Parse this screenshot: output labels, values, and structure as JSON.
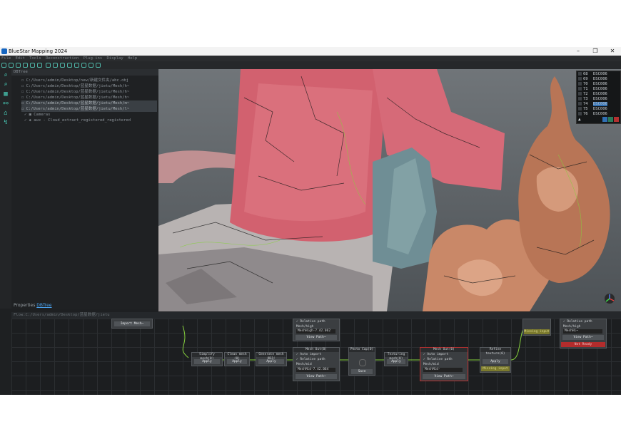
{
  "window": {
    "title": "BlueStar Mapping 2024",
    "minimize_glyph": "–",
    "maximize_glyph": "❐",
    "close_glyph": "✕"
  },
  "menu": [
    "File",
    "Edit",
    "Tools",
    "Reconstruction",
    "Plug-ins",
    "Display",
    "Help"
  ],
  "tree": {
    "title": "DBTree",
    "rows": [
      {
        "label": "C:/Users/admin/Desktop/new/新建文件夹/abc.obj"
      },
      {
        "label": "C:/Users/admin/Desktop/蓝星数据/jietu/Mesh/h~"
      },
      {
        "label": "C:/Users/admin/Desktop/蓝星数据/jietu/Mesh/h~"
      },
      {
        "label": "C:/Users/admin/Desktop/蓝星数据/jietu/Mesh/h~"
      },
      {
        "label": "C:/Users/admin/Desktop/蓝星数据/jietu/Mesh/m~"
      },
      {
        "label": "C:/Users/admin/Desktop/蓝星数据/jietu/Mesh/l~"
      },
      {
        "label": "Cameras"
      },
      {
        "label": "aux - Cloud_extract_registered_registered"
      }
    ]
  },
  "bottom_tabs": {
    "properties": "Properties",
    "dbtree": "DBTree"
  },
  "images": {
    "rows": [
      {
        "num": "68",
        "name": "DSC006"
      },
      {
        "num": "69",
        "name": "DSC006"
      },
      {
        "num": "70",
        "name": "DSC006"
      },
      {
        "num": "71",
        "name": "DSC006"
      },
      {
        "num": "72",
        "name": "DSC006"
      },
      {
        "num": "73",
        "name": "DSC006"
      },
      {
        "num": "74",
        "name": "DSC006"
      },
      {
        "num": "75",
        "name": "DSC006"
      },
      {
        "num": "76",
        "name": "DSC006"
      }
    ]
  },
  "flow": {
    "path_label": "Flow:C:/Users/admin/Desktop/蓝星数据/jietu",
    "nodes": {
      "import": {
        "button": "Import Mesh~"
      },
      "simplify": {
        "title": "Simplify mesh(0)",
        "button": "Apply"
      },
      "clean": {
        "title": "Clean mesh (0)",
        "button": "Apply"
      },
      "generate": {
        "title": "Generate mesh OBJ(",
        "button": "Apply"
      },
      "mesh_out_top": {
        "relative": "✓ Relative path",
        "mesh": "Mesh/high",
        "field": "MeshHigh-7.42.062",
        "button": "View Path~"
      },
      "mesh_out_mid": {
        "title": "Mesh Out(0)",
        "auto": "✓ Auto import",
        "relative": "✓ Relative path",
        "mesh": "Mesh/mid",
        "field": "MeshMid-7.42.064",
        "button": "View Path~"
      },
      "photo_cap": {
        "title": "Photo Cap(0)",
        "button": "Save"
      },
      "texturing": {
        "title": "Texturing mesh(0)",
        "button": "Apply"
      },
      "mesh_out_low": {
        "title": "Mesh Out(0)",
        "auto": "✓ Auto import",
        "relative": "✓ Relative path",
        "mesh": "Mesh/mid",
        "field": "MeshMid-",
        "button": "View Path~"
      },
      "refine": {
        "title": "Refine texture(0)",
        "button1": "Apply",
        "button2": "Missing input"
      },
      "right_top": {
        "relative": "✓ Relative path",
        "mesh": "Mesh/high",
        "field": "MeshHi~",
        "button": "View Path~",
        "missing": "Missing input",
        "notready": "Not Ready"
      }
    }
  },
  "colors": {
    "accent": "#47c3b0",
    "link": "#4aa3f0",
    "panel": "#1f2123"
  }
}
